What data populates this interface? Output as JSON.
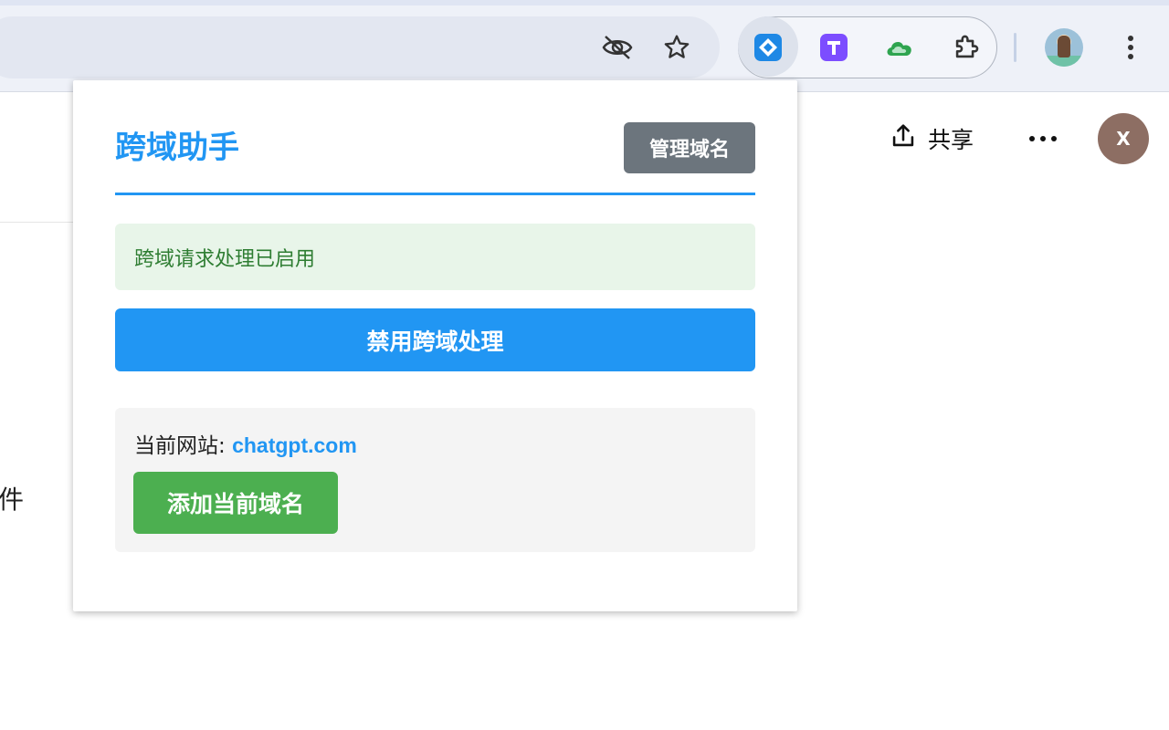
{
  "browser": {
    "toolbar_icons": [
      "eye-off-icon",
      "star-icon"
    ],
    "extensions": [
      "cors-helper-extension-icon",
      "t-extension-icon",
      "cloud-extension-icon",
      "extensions-puzzle-icon"
    ],
    "profile_avatar": "profile-avatar",
    "menu_icon": "vertical-dots-icon"
  },
  "page": {
    "share_label": "共享",
    "user_initial": "X",
    "partial_sidebar_text": "件"
  },
  "popup": {
    "title": "跨域助手",
    "manage_label": "管理域名",
    "status_text": "跨域请求处理已启用",
    "toggle_label": "禁用跨域处理",
    "current_site_label": "当前网站: ",
    "current_site_domain": "chatgpt.com",
    "add_domain_label": "添加当前域名"
  },
  "colors": {
    "primary_blue": "#2196f3",
    "status_green_bg": "#e8f5e9",
    "status_green_text": "#2e7d32",
    "gray_button": "#6c757d",
    "add_green": "#4caf50",
    "avatar_brown": "#8d6e63"
  }
}
